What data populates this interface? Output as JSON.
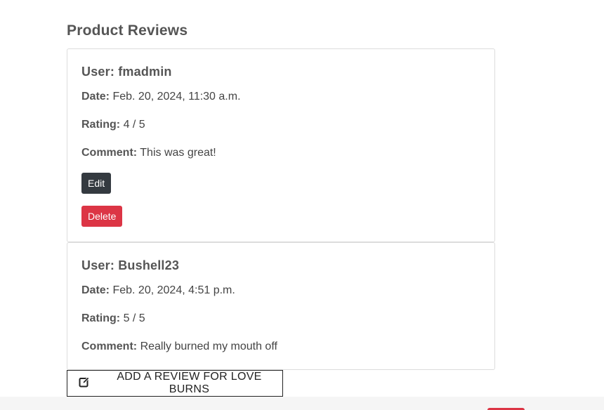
{
  "section": {
    "title": "Product Reviews"
  },
  "labels": {
    "date": "Date:",
    "rating": "Rating:",
    "comment": "Comment:"
  },
  "reviews": [
    {
      "user": "User: fmadmin",
      "date": "Feb. 20, 2024, 11:30 a.m.",
      "rating": "4 / 5",
      "comment": "This was great!",
      "edit_label": "Edit",
      "delete_label": "Delete"
    },
    {
      "user": "User: Bushell23",
      "date": "Feb. 20, 2024, 4:51 p.m.",
      "rating": "5 / 5",
      "comment": "Really burned my mouth off"
    }
  ],
  "add_review": {
    "label": "ADD A REVIEW FOR LOVE BURNS",
    "icon": "edit-icon"
  },
  "colors": {
    "edit_button": "#343a40",
    "delete_button": "#dc3545"
  }
}
